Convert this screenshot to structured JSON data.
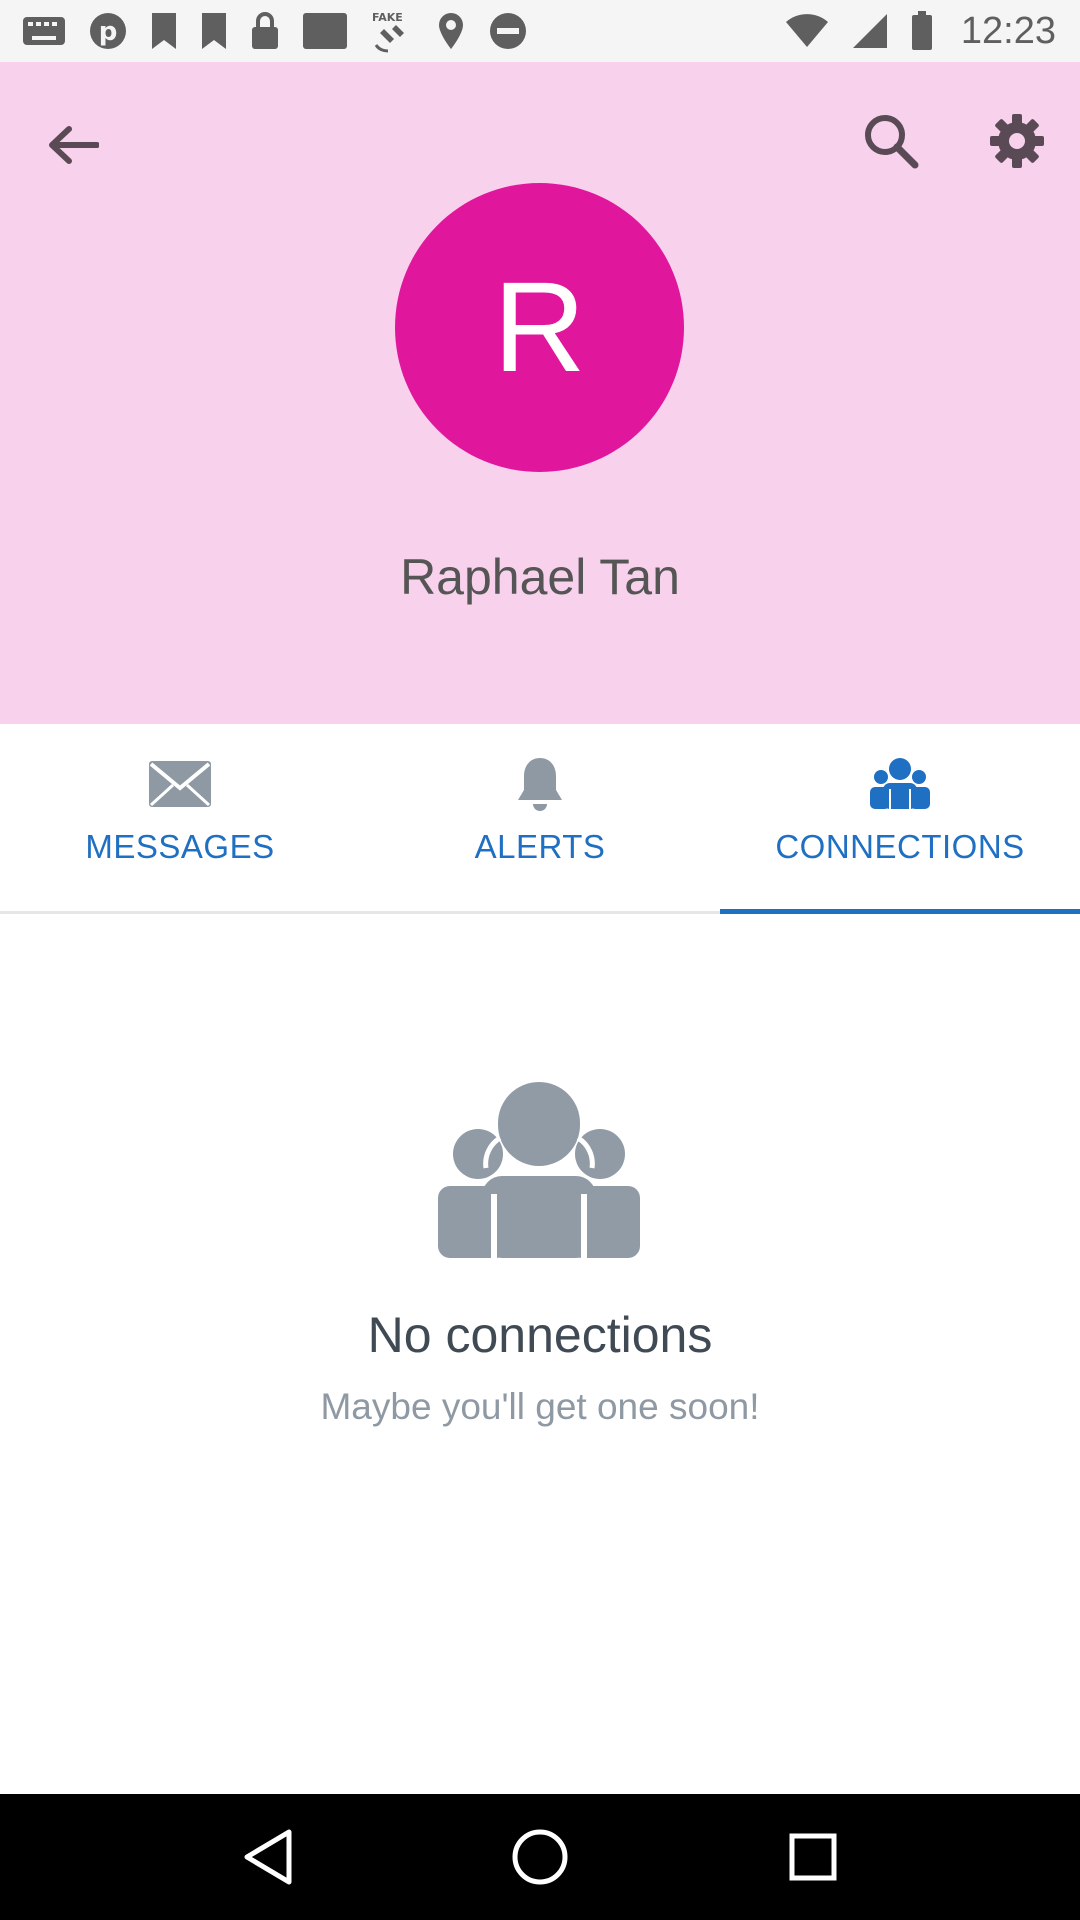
{
  "status_bar": {
    "time": "12:23",
    "icons": [
      "keyboard-icon",
      "pinterest-icon",
      "bookmark-icon",
      "bookmark-icon",
      "lock-icon",
      "square-icon",
      "fake-gps-icon",
      "location-icon",
      "do-not-disturb-icon",
      "wifi-icon",
      "signal-icon",
      "battery-icon"
    ]
  },
  "header": {
    "background": "#f8d1ec",
    "avatar_letter": "R",
    "avatar_color": "#e0169c",
    "name": "Raphael Tan"
  },
  "tabs": [
    {
      "label": "MESSAGES",
      "icon": "envelope-icon",
      "active": false
    },
    {
      "label": "ALERTS",
      "icon": "bell-icon",
      "active": false
    },
    {
      "label": "CONNECTIONS",
      "icon": "people-icon",
      "active": true
    }
  ],
  "empty_state": {
    "icon": "people-icon",
    "title": "No connections",
    "subtitle": "Maybe you'll get one soon!"
  },
  "nav_bar": {
    "buttons": [
      "back-triangle-icon",
      "home-circle-icon",
      "recents-square-icon"
    ]
  },
  "colors": {
    "accent": "#1f6fc2",
    "inactive_icon": "#8e99a4",
    "empty_icon": "#909ba6"
  }
}
